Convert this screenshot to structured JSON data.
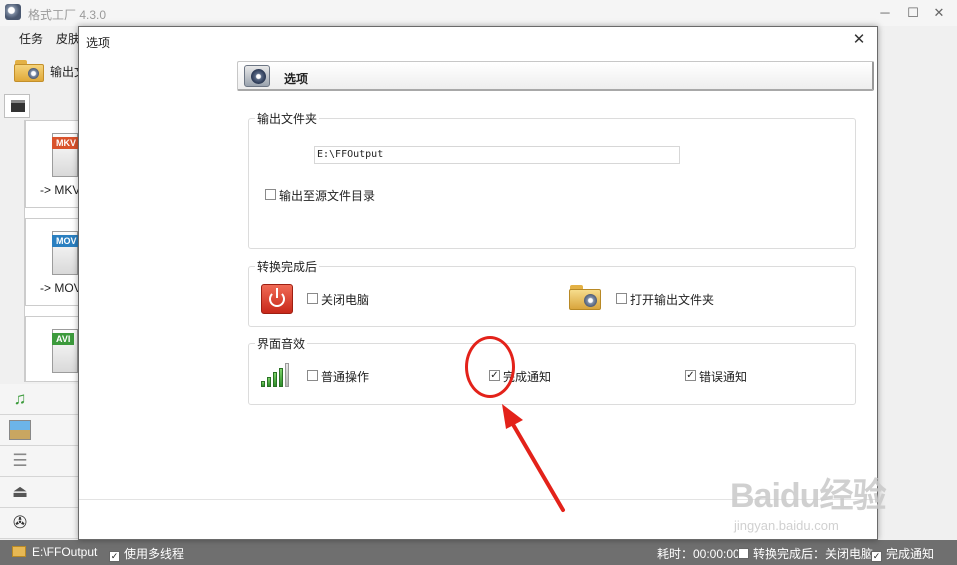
{
  "app": {
    "title": "格式工厂 4.3.0",
    "menu": [
      "任务",
      "皮肤"
    ],
    "toolbar_label": "输出文",
    "window_controls": [
      "minimize-icon",
      "maximize-icon",
      "close-icon"
    ]
  },
  "sidebar": {
    "formats": [
      {
        "badge": "MKV",
        "label": "-> MKV",
        "badge_color": "#d9532c"
      },
      {
        "badge": "MOV",
        "label": "-> MOV",
        "badge_color": "#2a7fc0"
      },
      {
        "badge": "AVI",
        "label": "",
        "badge_color": "#3c9a3c"
      }
    ],
    "categories": [
      "music-icon",
      "picture-icon",
      "document-icon",
      "rom-device-icon",
      "utilities-icon"
    ]
  },
  "dialog": {
    "title": "选项",
    "header_title": "选项",
    "output_folder": {
      "legend": "输出文件夹",
      "path": "E:\\FFOutput",
      "source_dir_label": "输出至源文件目录",
      "source_dir_checked": false
    },
    "after_convert": {
      "legend": "转换完成后",
      "shutdown_label": "关闭电脑",
      "shutdown_checked": false,
      "open_folder_label": "打开输出文件夹",
      "open_folder_checked": false
    },
    "sound": {
      "legend": "界面音效",
      "normal_label": "普通操作",
      "normal_checked": false,
      "complete_label": "完成通知",
      "complete_checked": true,
      "error_label": "错误通知",
      "error_checked": true
    }
  },
  "statusbar": {
    "path": "E:\\FFOutput",
    "multithread_label": "使用多线程",
    "multithread_checked": true,
    "elapsed": "耗时：00:00:00",
    "after_convert": "转换完成后：关闭电脑",
    "after_convert_checked": false,
    "notify": "完成通知",
    "notify_checked": true
  },
  "watermark": {
    "logo": "Baidu经验",
    "sub": "jingyan.baidu.com"
  },
  "colors": {
    "annotation": "#e3221a",
    "statusbar_bg": "#6f6f6f",
    "power_red": "#c8281a"
  }
}
